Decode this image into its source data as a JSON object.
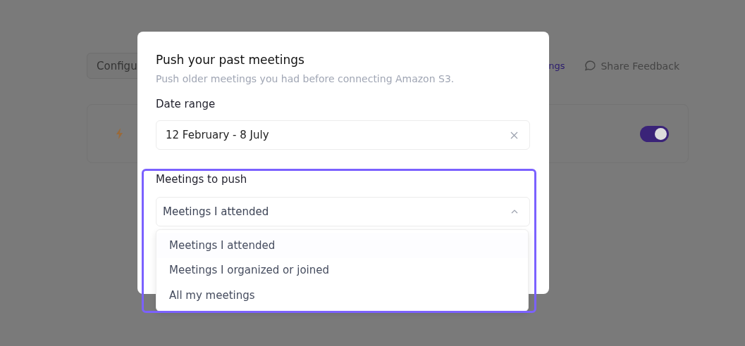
{
  "background": {
    "configure_button": "Configu",
    "settings_link": "ngs",
    "feedback_link": "Share Feedback",
    "card": {
      "toggle_on": true
    }
  },
  "dialog": {
    "title": "Push your past meetings",
    "subtitle": "Push older meetings you had before connecting Amazon S3.",
    "date_range": {
      "label": "Date range",
      "value": "12 February - 8 July"
    },
    "meetings": {
      "label": "Meetings to push",
      "value": "Meetings I attended",
      "expanded": true,
      "options": [
        {
          "label": "Meetings I attended",
          "selected": true
        },
        {
          "label": "Meetings I organized or joined",
          "selected": false
        },
        {
          "label": "All my meetings",
          "selected": false
        }
      ]
    }
  }
}
